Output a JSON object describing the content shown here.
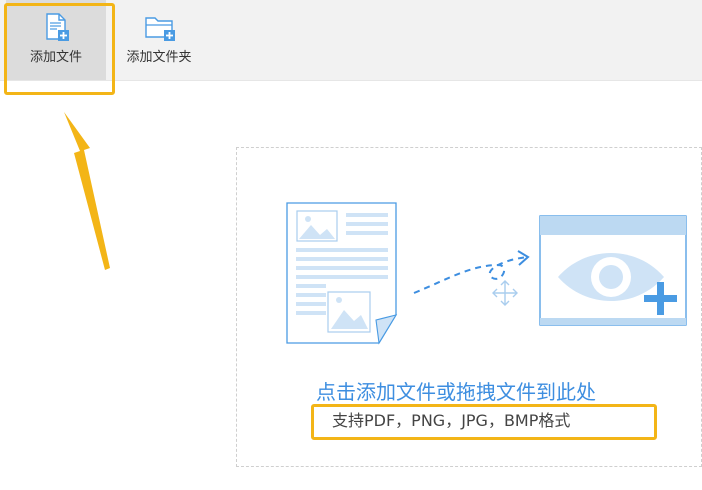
{
  "toolbar": {
    "add_file_label": "添加文件",
    "add_folder_label": "添加文件夹"
  },
  "dropzone": {
    "title": "点击添加文件或拖拽文件到此处",
    "subtitle": "支持PDF，PNG，JPG，BMP格式"
  },
  "colors": {
    "accent": "#3d8ee0",
    "highlight": "#f3b517",
    "icon_blue": "#4a9be3"
  }
}
